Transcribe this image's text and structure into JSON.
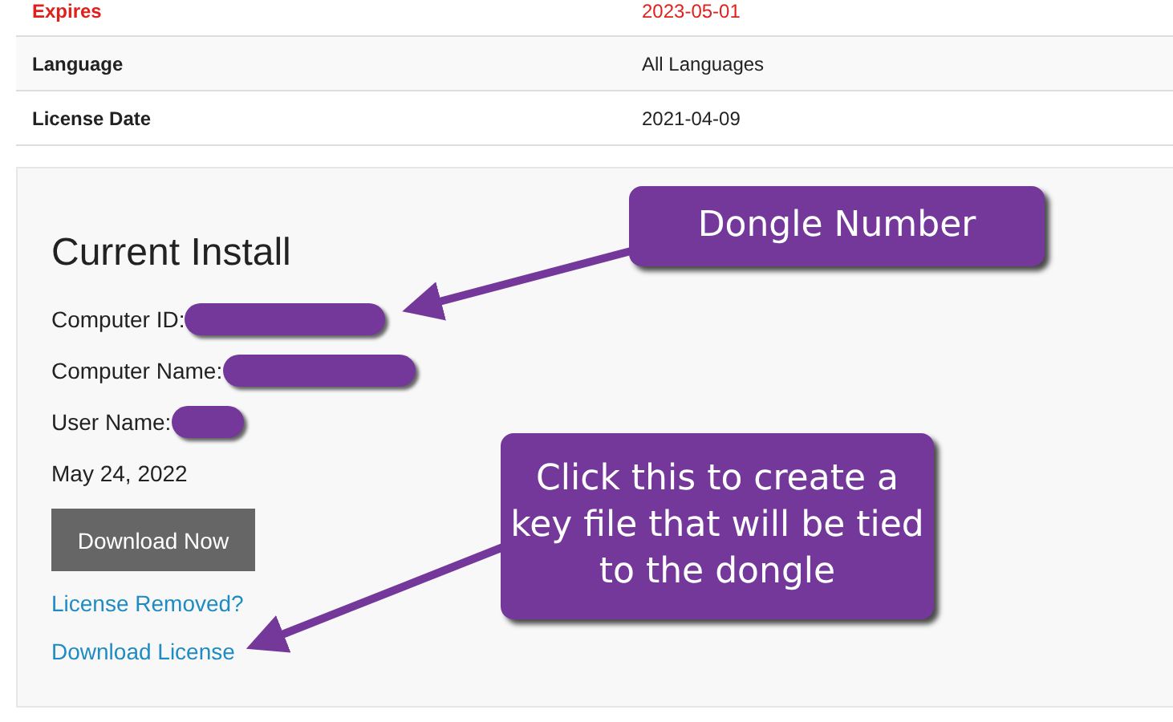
{
  "table": {
    "rows": [
      {
        "label": "Expires",
        "value": "2023-05-01",
        "kind": "alert"
      },
      {
        "label": "Language",
        "value": "All Languages",
        "kind": "normal"
      },
      {
        "label": "License Date",
        "value": "2021-04-09",
        "kind": "normal"
      }
    ]
  },
  "current_install": {
    "title": "Current Install",
    "fields": [
      {
        "label": "Computer ID:",
        "redacted": true
      },
      {
        "label": "Computer Name:",
        "redacted": true
      },
      {
        "label": "User Name:",
        "redacted": true
      }
    ],
    "date": "May 24, 2022",
    "button": "Download Now",
    "links": [
      "License Removed?",
      "Download License"
    ]
  },
  "callouts": [
    {
      "text": "Dongle Number"
    },
    {
      "text": "Click this to create a key file that will be tied to the dongle"
    }
  ]
}
